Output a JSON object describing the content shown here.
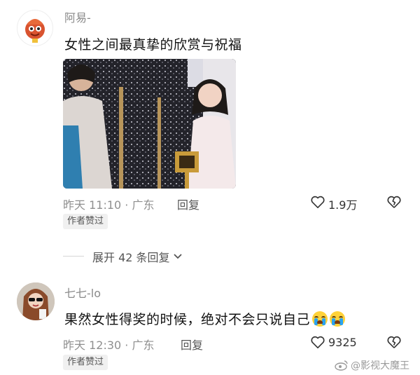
{
  "comments": [
    {
      "username": "阿易-",
      "text": "女性之间最真挚的欣赏与祝福",
      "meta": "昨天 11:10 · 广东",
      "reply_label": "回复",
      "like_count": "1.9万",
      "badge": "作者赞过"
    },
    {
      "username": "七七-lo",
      "text": "果然女性得奖的时候，绝对不会只说自己",
      "meta": "昨天 12:30 · 广东",
      "reply_label": "回复",
      "like_count": "9325",
      "badge": "作者赞过"
    }
  ],
  "expand_replies": "展开 42 条回复",
  "watermark": "@影视大魔王",
  "icons": {
    "like": "heart-outline-icon",
    "dislike": "broken-heart-icon",
    "expand": "chevron-down-icon",
    "weibo": "weibo-logo-icon",
    "emoji": "crying-face-emoji"
  },
  "colors": {
    "muted_text": "#8f8f8f",
    "badge_bg": "#f0f0f0",
    "emoji_yellow": "#ffd23a"
  }
}
